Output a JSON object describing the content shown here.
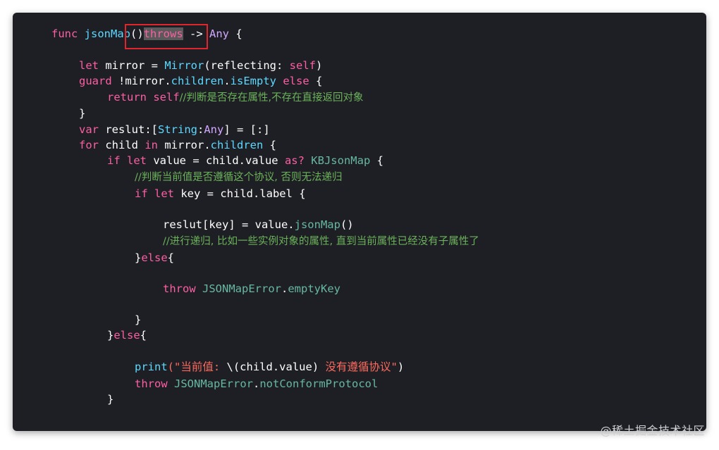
{
  "code": {
    "l1": {
      "kw1": "func",
      "name": "jsonMap",
      "paren": "()",
      "throws": "throws",
      "arrow": " -> ",
      "ret": "Any",
      "brace": " {"
    },
    "l2": {
      "kw": "let",
      "plain1": " mirror = ",
      "ty": "Mirror",
      "plain2": "(reflecting: ",
      "kw2": "self",
      "plain3": ")"
    },
    "l3": {
      "kw": "guard",
      "op": " !",
      "plain1": "mirror.",
      "prop1": "children",
      "dot": ".",
      "prop2": "isEmpty",
      "kw2": " else",
      "plain2": " {"
    },
    "l4": {
      "kw": "return",
      "kw2": " self",
      "comment": "//判断是否存在属性,不存在直接返回对象"
    },
    "l5": {
      "plain": "}"
    },
    "l6": {
      "kw": "var",
      "plain1": " reslut:[",
      "ty1": "String",
      "plain2": ":",
      "ty2": "Any",
      "plain3": "] = [:]"
    },
    "l7": {
      "kw": "for",
      "plain1": " child ",
      "kw2": "in",
      "plain2": " mirror.",
      "prop": "children",
      "plain3": " {"
    },
    "l8": {
      "kw": "if",
      "kw2": " let",
      "plain1": " value = child.value ",
      "kw3": "as?",
      "ty": " KBJsonMap",
      "plain2": " {"
    },
    "l9": {
      "comment": "//判断当前值是否遵循这个协议, 否则无法递归"
    },
    "l10": {
      "kw": "if",
      "kw2": " let",
      "plain": " key = child.label {"
    },
    "l11": {
      "plain1": "reslut[key] = value.",
      "method": "jsonMap",
      "plain2": "()"
    },
    "l12": {
      "comment": "//进行递归, 比如一些实例对象的属性, 直到当前属性已经没有子属性了"
    },
    "l13": {
      "plain1": "}",
      "kw": "else",
      "plain2": "{"
    },
    "l14": {
      "kw": "throw",
      "ty": " JSONMapError",
      "plain": ".",
      "prop": "emptyKey"
    },
    "l15": {
      "plain": "}"
    },
    "l16": {
      "plain1": "}",
      "kw": "else",
      "plain2": "{"
    },
    "l17": {
      "fn": "print",
      "str1": "(\"当前值: ",
      "plain": "\\(child.value)",
      "str2": " 没有遵循协议\"",
      "close": ")"
    },
    "l18": {
      "kw": "throw",
      "ty": " JSONMapError",
      "plain": ".",
      "prop": "notConformProtocol"
    },
    "l19": {
      "plain": "}"
    }
  },
  "watermark": "@稀土掘金技术社区",
  "colors": {
    "background": "#1e1f24",
    "keyword": "#fc5fa3",
    "type": "#5dd8ff",
    "method": "#67b7a4",
    "comment": "#6bb35a",
    "string": "#fc6a5d",
    "highlight_box": "#e0262c"
  }
}
